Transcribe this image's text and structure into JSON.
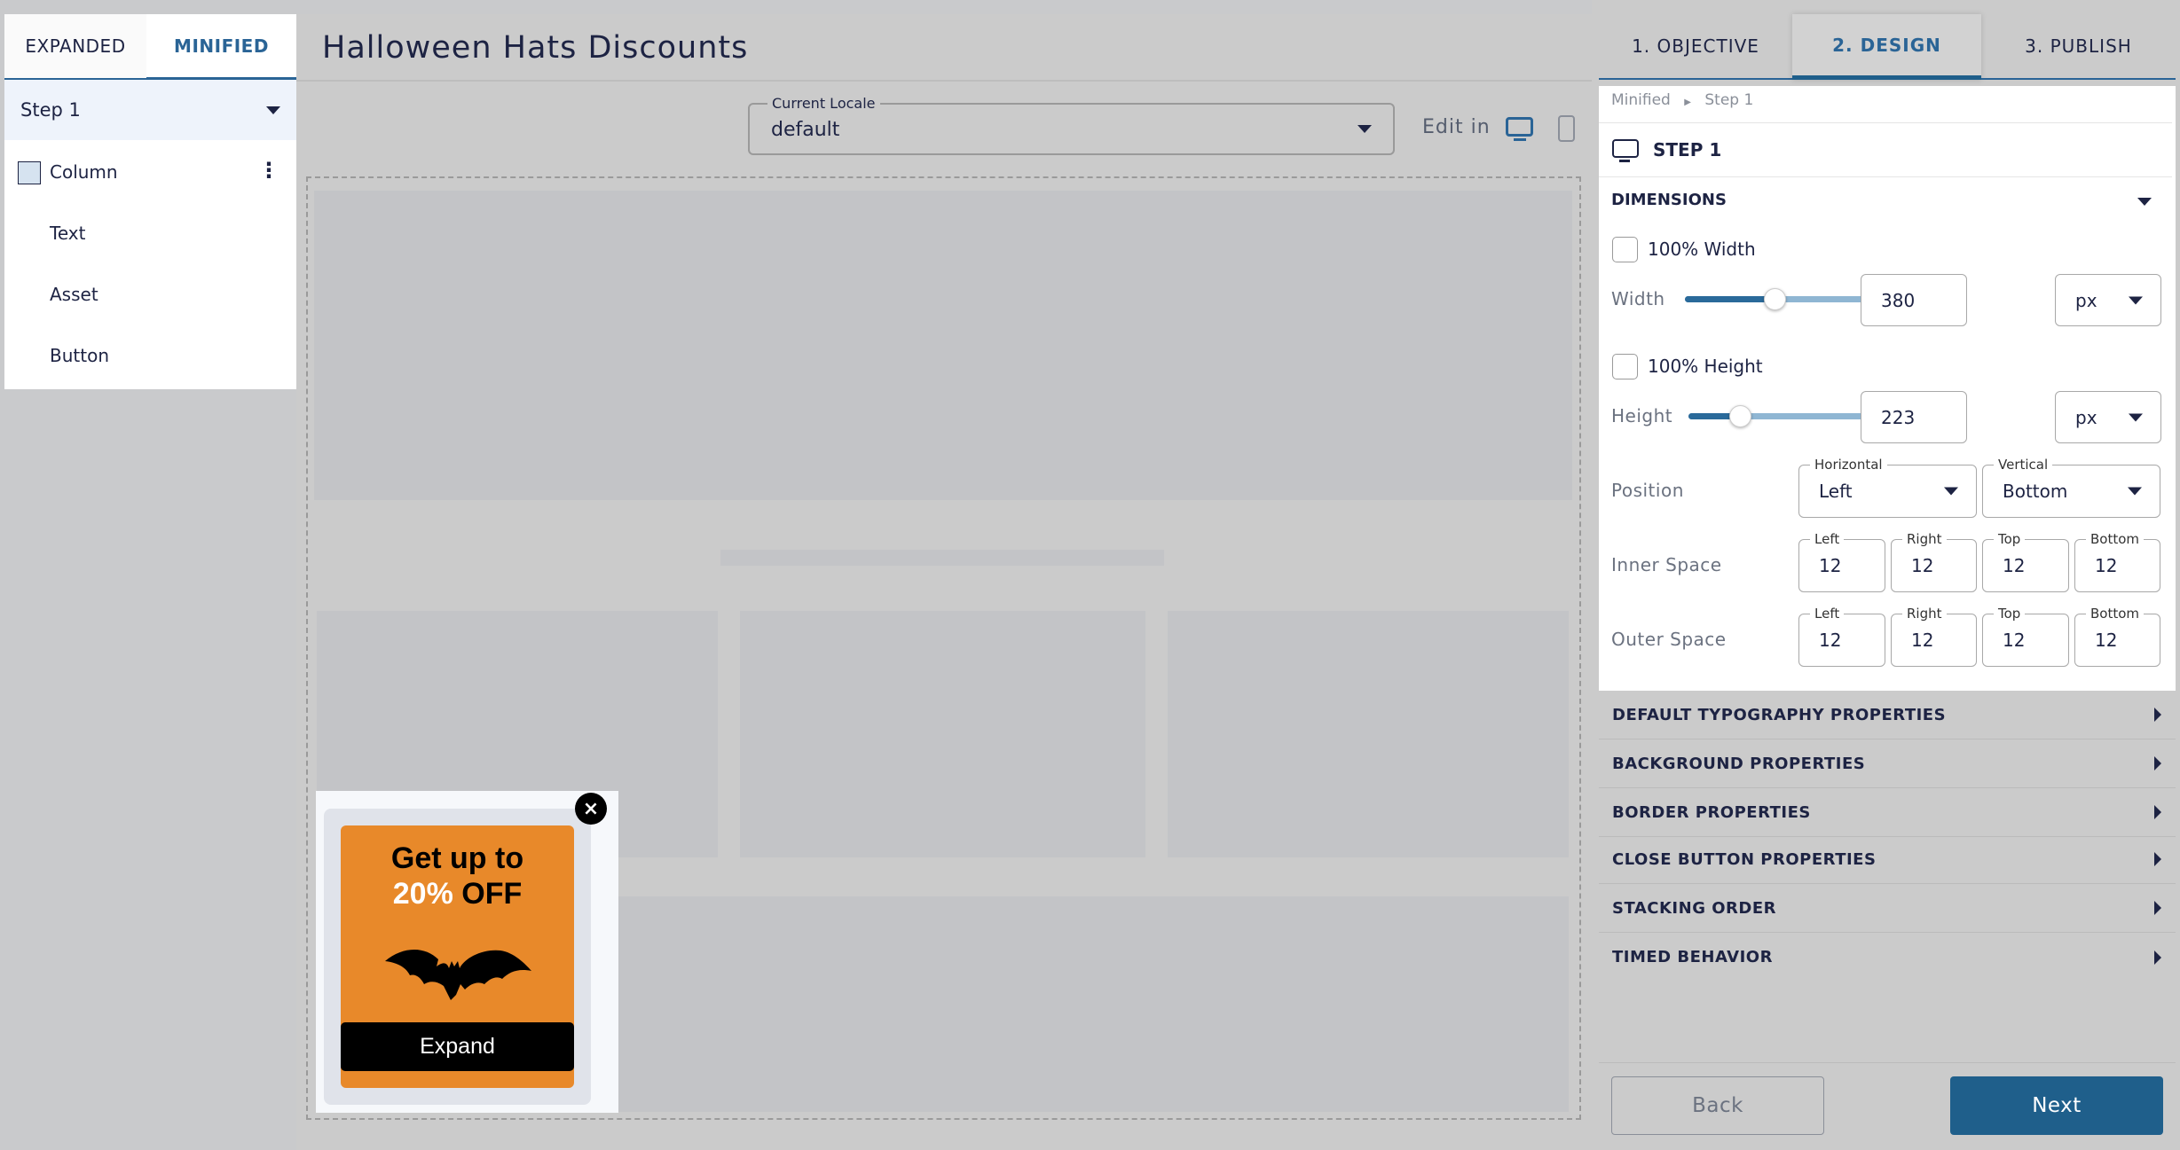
{
  "left_panel": {
    "tabs": [
      {
        "label": "EXPANDED",
        "active": false
      },
      {
        "label": "MINIFIED",
        "active": true
      }
    ],
    "step": "Step 1",
    "items": [
      {
        "label": "Column",
        "icon": "column-square-icon"
      },
      {
        "label": "Text"
      },
      {
        "label": "Asset"
      },
      {
        "label": "Button"
      }
    ]
  },
  "header": {
    "title": "Halloween Hats Discounts"
  },
  "locale": {
    "label": "Current Locale",
    "value": "default"
  },
  "edit_in": {
    "label": "Edit in",
    "icons": [
      "desktop-icon",
      "mobile-icon"
    ],
    "active": "desktop"
  },
  "popup": {
    "line1": "Get up to",
    "line2_highlight": "20%",
    "line2_rest": "OFF",
    "button": "Expand",
    "background_color": "#e8892a",
    "close": "×"
  },
  "right_panel": {
    "tabs": [
      {
        "label": "1. OBJECTIVE"
      },
      {
        "label": "2. DESIGN",
        "active": true
      },
      {
        "label": "3. PUBLISH"
      }
    ],
    "breadcrumb": [
      "Minified",
      "Step 1"
    ],
    "step_title": "STEP 1",
    "dimensions": {
      "title": "DIMENSIONS",
      "full_width_label": "100% Width",
      "full_width_checked": false,
      "width_label": "Width",
      "width_value": "380",
      "width_unit": "px",
      "width_slider_fraction": 0.38,
      "full_height_label": "100% Height",
      "full_height_checked": false,
      "height_label": "Height",
      "height_value": "223",
      "height_unit": "px",
      "height_slider_fraction": 0.22,
      "position_label": "Position",
      "horizontal_label": "Horizontal",
      "horizontal_value": "Left",
      "vertical_label": "Vertical",
      "vertical_value": "Bottom",
      "inner_label": "Inner Space",
      "outer_label": "Outer Space",
      "spacing_fields": [
        "Left",
        "Right",
        "Top",
        "Bottom"
      ],
      "inner": [
        "12",
        "12",
        "12",
        "12"
      ],
      "outer": [
        "12",
        "12",
        "12",
        "12"
      ]
    },
    "sections": [
      "DEFAULT TYPOGRAPHY PROPERTIES",
      "BACKGROUND PROPERTIES",
      "BORDER PROPERTIES",
      "CLOSE BUTTON PROPERTIES",
      "STACKING ORDER",
      "TIMED BEHAVIOR"
    ],
    "back": "Back",
    "next": "Next",
    "accent": "#1f5f8b"
  }
}
